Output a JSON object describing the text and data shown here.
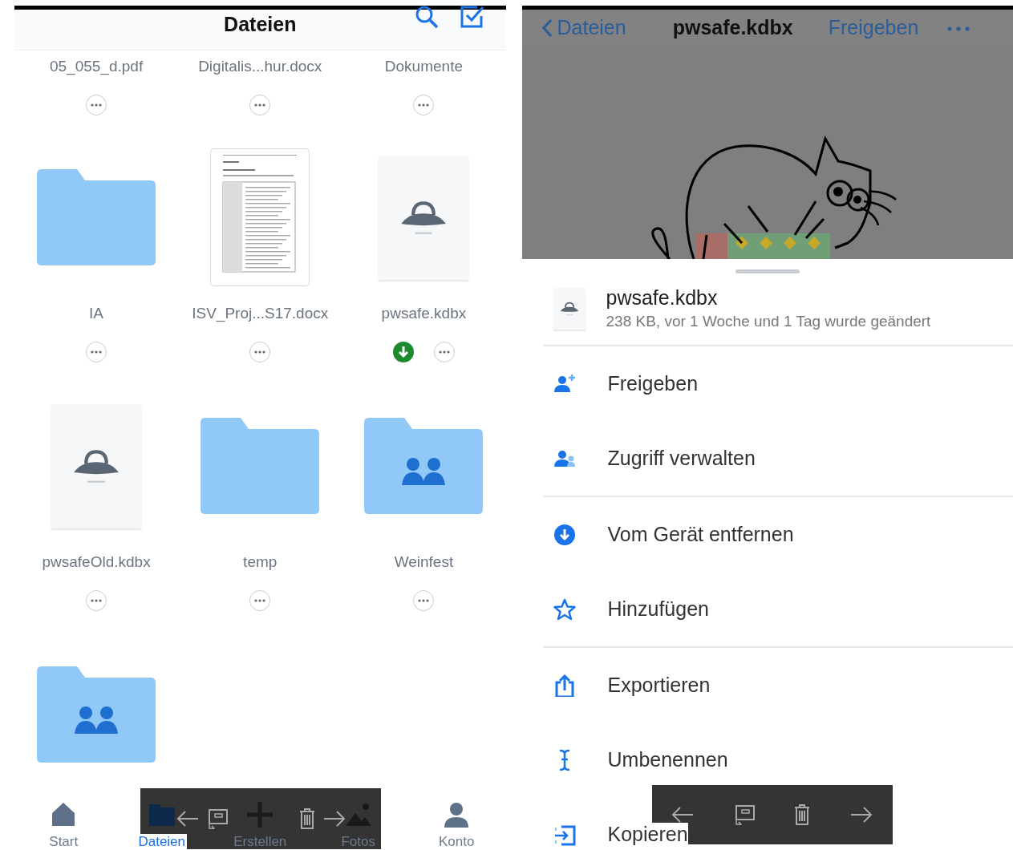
{
  "left": {
    "title": "Dateien",
    "tiles": [
      {
        "name": "05_055_d.pdf",
        "kind": "hidden",
        "offline": false
      },
      {
        "name": "Digitalis...hur.docx",
        "kind": "hidden",
        "offline": false
      },
      {
        "name": "Dokumente",
        "kind": "hidden",
        "offline": false
      },
      {
        "name": "IA",
        "kind": "folder",
        "offline": false
      },
      {
        "name": "ISV_Proj...S17.docx",
        "kind": "document",
        "offline": false
      },
      {
        "name": "pwsafe.kdbx",
        "kind": "kdbx",
        "offline": true
      },
      {
        "name": "pwsafeOld.kdbx",
        "kind": "kdbx",
        "offline": false
      },
      {
        "name": "temp",
        "kind": "folder",
        "offline": false
      },
      {
        "name": "Weinfest",
        "kind": "shared-folder",
        "offline": false
      },
      {
        "kind": "shared-folder"
      }
    ],
    "tabs": [
      {
        "label": "Start",
        "kind": "home",
        "selected": false
      },
      {
        "label": "Dateien",
        "kind": "folder",
        "selected": true
      },
      {
        "label": "Erstellen",
        "kind": "plus",
        "selected": false
      },
      {
        "label": "Fotos",
        "kind": "photo",
        "selected": false
      },
      {
        "label": "Konto",
        "kind": "person",
        "selected": false
      }
    ]
  },
  "right": {
    "back": "Dateien",
    "title": "pwsafe.kdbx",
    "action": "Freigeben",
    "file": {
      "name": "pwsafe.kdbx",
      "meta": "238 KB, vor 1 Woche und 1 Tag wurde geändert"
    },
    "menu": [
      [
        {
          "label": "Freigeben",
          "kind": "add-person"
        },
        {
          "label": "Zugriff verwalten",
          "kind": "people"
        }
      ],
      [
        {
          "label": "Vom Gerät entfernen",
          "kind": "download"
        },
        {
          "label": "Hinzufügen",
          "kind": "star"
        }
      ],
      [
        {
          "label": "Exportieren",
          "kind": "export"
        },
        {
          "label": "Umbenennen",
          "kind": "cursor"
        },
        {
          "label": "Kopieren",
          "kind": "copy"
        }
      ]
    ]
  }
}
